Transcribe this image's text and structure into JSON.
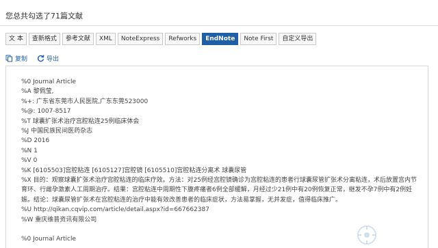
{
  "header": {
    "title": "您总共勾选了71篇文献"
  },
  "tabs": [
    {
      "label": "文 本",
      "active": false
    },
    {
      "label": "查新格式",
      "active": false
    },
    {
      "label": "参考文献",
      "active": false
    },
    {
      "label": "XML",
      "active": false
    },
    {
      "label": "NoteExpress",
      "active": false
    },
    {
      "label": "Refworks",
      "active": false
    },
    {
      "label": "EndNote",
      "active": true
    },
    {
      "label": "Note First",
      "active": false
    },
    {
      "label": "自定义导出",
      "active": false
    }
  ],
  "actions": {
    "copy": {
      "label": "复制",
      "icon": "copy-icon"
    },
    "export": {
      "label": "导出",
      "icon": "export-icon"
    }
  },
  "record1": [
    "%0 Journal Article",
    "%A 黎佩莹,",
    "%+: 广东省东莞市人民医院,广东东莞523000",
    "%@: 1007-8517",
    "%T 球囊扩张术治疗宫腔粘连25例临床体会",
    "%J 中国民族民间医药杂志",
    "%D 2016",
    "%N 1",
    "%V 0",
    "%K [6105503]宫腔粘连 [6105127]宫腔镜 [6105510]宫腔粘连分离术 球囊尿管",
    "%X 目的：观察球囊扩张术治疗宫腔粘连的临床疗效。方法：对25例经宫腔镜确诊为宫腔粘连的患者行球囊尿管扩张术分离粘连，术后放置宫内节育环、行雌孕激素人工周期治疗。结果：宫腔粘连中周期性下腹疼痛者6例全部缓解，月经过少21例中有20例恢复正常，继发不孕7例中有2例妊娠。结论：球囊尿管扩张术在宫腔粘连的治疗中能有效改善患者的临床症状，方法易掌握，无并发症，值得临床推广。",
    "%U http://qikan.cqvip.com/article/detail.aspx?id=667662387",
    "%W 重庆维普资讯有限公司"
  ],
  "record2": [
    "%0 Journal Article"
  ],
  "watermark": "丁香园",
  "colors": {
    "accent": "#1f5fa8",
    "watermark": "#7fa9c9"
  }
}
